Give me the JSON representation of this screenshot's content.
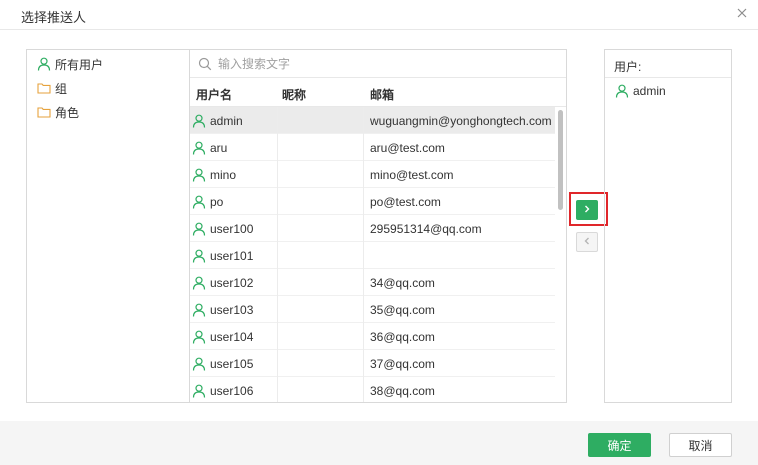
{
  "dialog": {
    "title": "选择推送人"
  },
  "tree": {
    "items": [
      {
        "label": "所有用户",
        "icon": "user-icon"
      },
      {
        "label": "组",
        "icon": "folder-icon"
      },
      {
        "label": "角色",
        "icon": "folder-icon"
      }
    ]
  },
  "search": {
    "placeholder": "输入搜索文字",
    "value": ""
  },
  "table": {
    "headers": {
      "name": "用户名",
      "nickname": "昵称",
      "email": "邮箱"
    },
    "rows": [
      {
        "name": "admin",
        "nickname": "",
        "email": "wuguangmin@yonghongtech.com",
        "selected": true
      },
      {
        "name": "aru",
        "nickname": "",
        "email": "aru@test.com"
      },
      {
        "name": "mino",
        "nickname": "",
        "email": "mino@test.com"
      },
      {
        "name": "po",
        "nickname": "",
        "email": "po@test.com"
      },
      {
        "name": "user100",
        "nickname": "",
        "email": "295951314@qq.com"
      },
      {
        "name": "user101",
        "nickname": "",
        "email": ""
      },
      {
        "name": "user102",
        "nickname": "",
        "email": "34@qq.com"
      },
      {
        "name": "user103",
        "nickname": "",
        "email": "35@qq.com"
      },
      {
        "name": "user104",
        "nickname": "",
        "email": "36@qq.com"
      },
      {
        "name": "user105",
        "nickname": "",
        "email": "37@qq.com"
      },
      {
        "name": "user106",
        "nickname": "",
        "email": "38@qq.com"
      }
    ]
  },
  "selected": {
    "header": "用户:",
    "items": [
      {
        "name": "admin"
      }
    ]
  },
  "footer": {
    "ok_label": "确定",
    "cancel_label": "取消"
  },
  "colors": {
    "accent": "#2ead62",
    "highlight": "#e0262a",
    "selected_row": "#ebebeb"
  }
}
